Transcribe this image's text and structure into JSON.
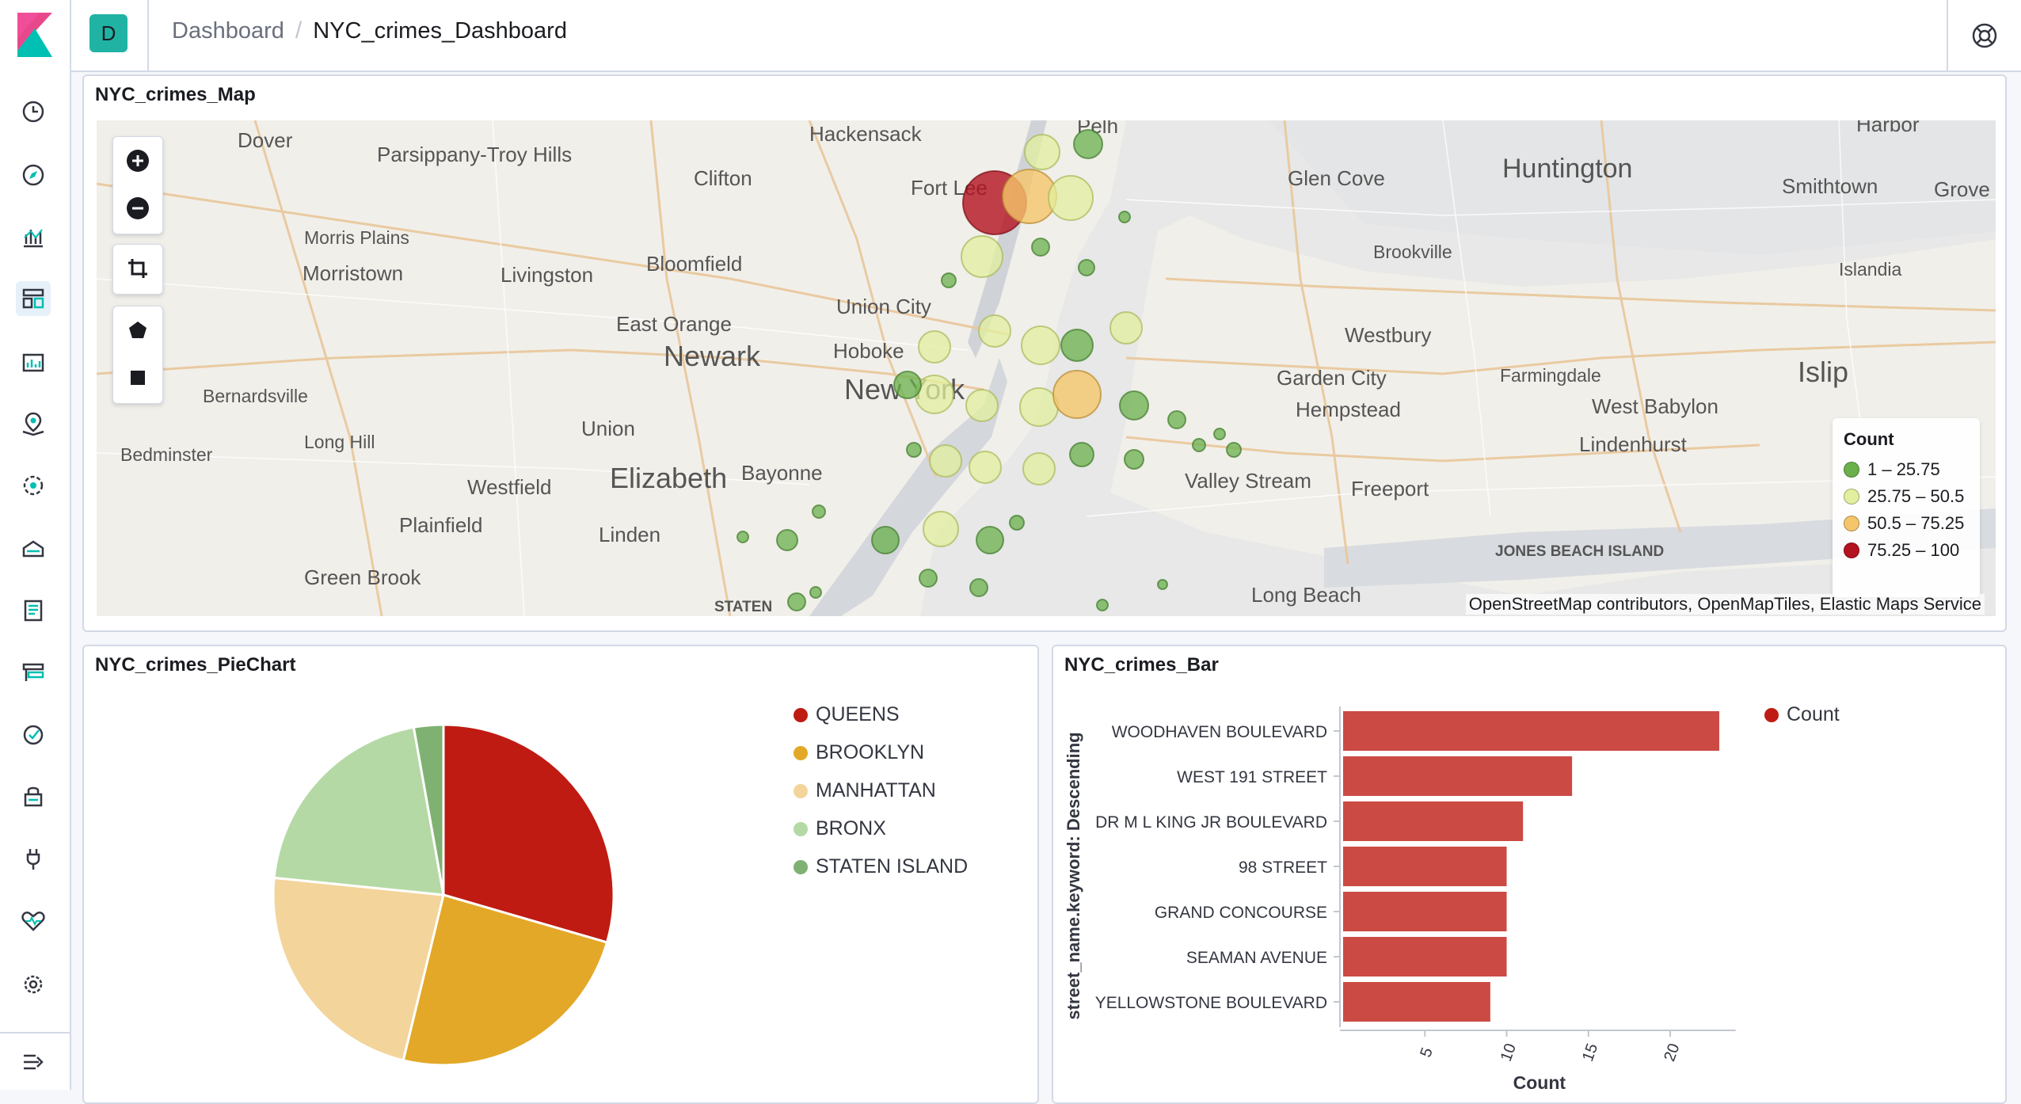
{
  "header": {
    "space_initial": "D",
    "breadcrumbs": [
      "Dashboard",
      "NYC_crimes_Dashboard"
    ],
    "separator": "/"
  },
  "nav": {
    "icons": [
      "clock-icon",
      "discover-compass-icon",
      "visualize-icon",
      "dashboard-icon",
      "canvas-icon",
      "maps-icon",
      "ml-icon",
      "infrastructure-icon",
      "logs-icon",
      "apm-icon",
      "uptime-icon",
      "siem-icon",
      "dev-tools-icon",
      "monitoring-icon",
      "management-gear-icon",
      "collapse-nav-icon"
    ]
  },
  "map_panel": {
    "title": "NYC_crimes_Map",
    "legend_title": "Count",
    "legend": [
      {
        "label": "1 – 25.75",
        "color": "#6ab04c"
      },
      {
        "label": "25.75 – 50.5",
        "color": "#e2ef9e"
      },
      {
        "label": "50.5 – 75.25",
        "color": "#f5c56b"
      },
      {
        "label": "75.25 – 100",
        "color": "#b3121f"
      }
    ],
    "attribution": "OpenStreetMap contributors, OpenMapTiles, Elastic Maps Service",
    "place_labels": [
      "Dover",
      "Parsippany-Troy Hills",
      "Hackensack",
      "Clifton",
      "Fort Lee",
      "Pelh",
      "Glen Cove",
      "Huntington",
      "Harbor",
      "Smithtown",
      "Grove",
      "Morris Plains",
      "Morristown",
      "Livingston",
      "Bloomfield",
      "Union City",
      "East Orange",
      "Newark",
      "Hoboke",
      "New York",
      "Brookville",
      "Islandia",
      "Westbury",
      "Garden City",
      "Hempstead",
      "Farmingdale",
      "West Babylon",
      "Islip",
      "Lindenhurst",
      "Bernardsville",
      "Bedminster",
      "Long Hill",
      "Union",
      "Elizabeth",
      "Bayonne",
      "Westfield",
      "Plainfield",
      "Linden",
      "Valley Stream",
      "Freeport",
      "Green Brook",
      "Long Beach",
      "JONES BEACH ISLAND",
      "STATEN"
    ]
  },
  "pie_panel": {
    "title": "NYC_crimes_PieChart",
    "legend": [
      {
        "label": "QUEENS",
        "color": "#bf1b13"
      },
      {
        "label": "BROOKLYN",
        "color": "#e3a828"
      },
      {
        "label": "MANHATTAN",
        "color": "#f3d49a"
      },
      {
        "label": "BRONX",
        "color": "#b5d9a5"
      },
      {
        "label": "STATEN ISLAND",
        "color": "#7fb272"
      }
    ]
  },
  "bar_panel": {
    "title": "NYC_crimes_Bar",
    "legend_label": "Count",
    "legend_color": "#bf1b13"
  },
  "chart_data": [
    {
      "type": "pie",
      "title": "NYC_crimes_PieChart",
      "categories": [
        "QUEENS",
        "BROOKLYN",
        "MANHATTAN",
        "BRONX",
        "STATEN ISLAND"
      ],
      "values": [
        29.5,
        24.3,
        22.8,
        20.6,
        2.8
      ],
      "colors": [
        "#bf1b13",
        "#e3a828",
        "#f3d49a",
        "#b5d9a5",
        "#7fb272"
      ]
    },
    {
      "type": "bar",
      "orientation": "horizontal",
      "title": "NYC_crimes_Bar",
      "ylabel": "street_name.keyword: Descending",
      "xlabel": "Count",
      "series_name": "Count",
      "color": "#cc4a44",
      "categories": [
        "WOODHAVEN BOULEVARD",
        "WEST 191 STREET",
        "DR M L KING JR BOULEVARD",
        "98 STREET",
        "GRAND CONCOURSE",
        "SEAMAN AVENUE",
        "YELLOWSTONE BOULEVARD"
      ],
      "values": [
        23,
        14,
        11,
        10,
        10,
        10,
        9
      ],
      "xticks": [
        5,
        10,
        15,
        20
      ],
      "xlim": [
        0,
        24
      ]
    }
  ]
}
